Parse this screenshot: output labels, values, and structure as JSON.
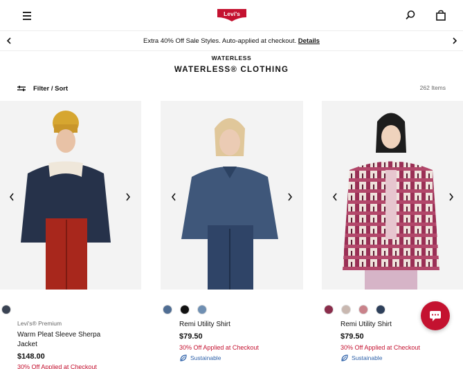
{
  "header": {
    "menu_icon": "hamburger-icon",
    "logo_text": "Levi's",
    "search_icon": "search-icon",
    "bag_icon": "bag-icon",
    "brand_red": "#c41230"
  },
  "promo": {
    "text": "Extra 40% Off Sale Styles. Auto-applied at checkout.",
    "link": "Details"
  },
  "breadcrumb": "WATERLESS",
  "title": "WATERLESS® CLOTHING",
  "filter": {
    "label": "Filter / Sort",
    "icon": "sliders-icon"
  },
  "count": "262 Items",
  "products": [
    {
      "brand": "Levi's® Premium",
      "name": "Warm Pleat Sleeve Sherpa Jacket",
      "name_line1": "Warm Pleat Sleeve Sherpa",
      "name_line2": "Jacket",
      "price": "$148.00",
      "promo": "30% Off Applied at Checkout",
      "swatches": [
        "#3a4353"
      ]
    },
    {
      "name": "Remi Utility Shirt",
      "price": "$79.50",
      "promo": "30% Off Applied at Checkout",
      "sustain": "Sustainable",
      "swatches": [
        "#4f6d93",
        "#111111",
        "#6f8fb2"
      ]
    },
    {
      "name": "Remi Utility Shirt",
      "price": "$79.50",
      "promo": "30% Off Applied at Checkout",
      "sustain": "Sustainable",
      "swatches": [
        "#8a2d4b",
        "#c9b8b0",
        "#c9828a",
        "#2d3f5a"
      ]
    }
  ],
  "chat_icon": "chat-icon"
}
